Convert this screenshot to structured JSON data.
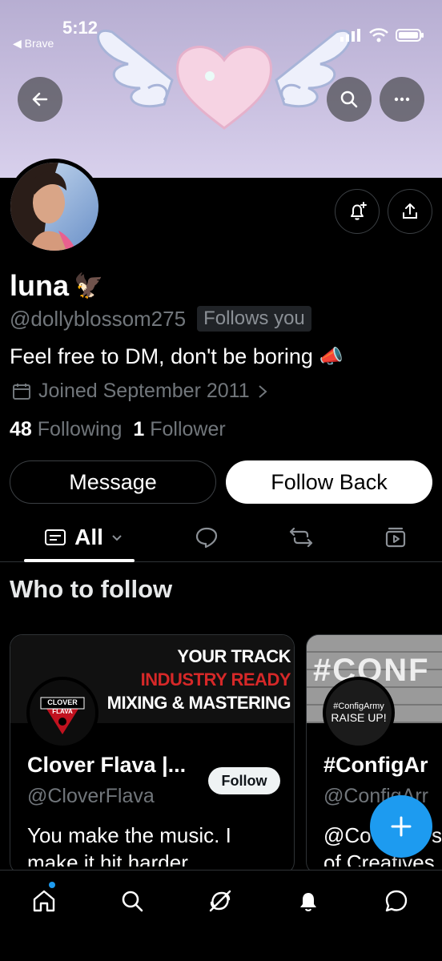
{
  "status_bar": {
    "time": "5:12",
    "back_app": "◀ Brave"
  },
  "profile": {
    "name": "luna",
    "name_emoji": "🦅",
    "handle": "@dollyblossom275",
    "follows_you": "Follows you",
    "bio": "Feel free to DM, don't be boring",
    "bio_emoji": "📣",
    "joined": "Joined September 2011",
    "following_count": "48",
    "following_label": "Following",
    "followers_count": "1",
    "followers_label": "Follower"
  },
  "actions": {
    "message": "Message",
    "follow_back": "Follow Back"
  },
  "tabs": {
    "all_label": "All"
  },
  "who_to_follow": {
    "title": "Who to follow",
    "cards": [
      {
        "banner_line1": "YOUR TRACK",
        "banner_line2": "INDUSTRY READY",
        "banner_line3": "MIXING & MASTERING",
        "logo_text_1": "CLOVER",
        "logo_text_2": "FLAVA",
        "name": "Clover Flava |...",
        "handle": "@CloverFlava",
        "bio_line1": "You make the music. I",
        "bio_line2": "make it hit harder.",
        "follow_label": "Follow"
      },
      {
        "banner_text": "#CONF",
        "avatar_line1": "#ConfigArmy",
        "avatar_line2": "RAISE UP!",
        "name": "#ConfigAr",
        "handle": "@ConfigArr",
        "bio_line1": "@Co",
        "bio_line1_tail": "s",
        "bio_line2": "of Creatives"
      }
    ]
  },
  "colors": {
    "accent": "#1d9bf0",
    "background": "#000000",
    "muted": "#71767b",
    "banner": "#c9c0e0"
  },
  "icons": [
    "back-arrow-icon",
    "search-icon",
    "more-icon",
    "notify-plus-icon",
    "share-icon",
    "calendar-icon",
    "chevron-right-icon",
    "list-icon",
    "chevron-down-icon",
    "reply-icon",
    "repost-icon",
    "media-icon",
    "plus-icon",
    "home-icon",
    "explore-icon",
    "grok-icon",
    "bell-icon",
    "chat-icon"
  ]
}
